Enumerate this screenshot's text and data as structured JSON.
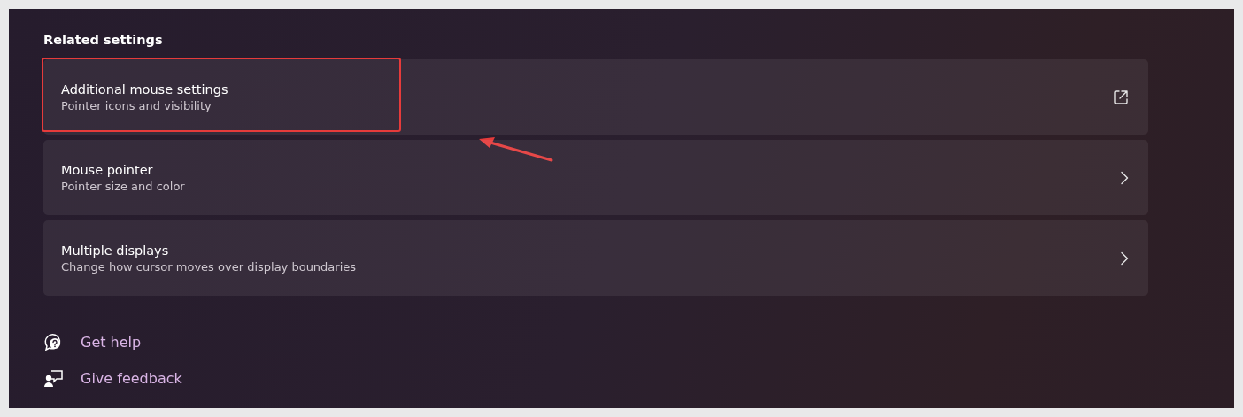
{
  "section_title": "Related settings",
  "rows": [
    {
      "title": "Additional mouse settings",
      "subtitle": "Pointer icons and visibility",
      "kind": "external",
      "highlighted": true
    },
    {
      "title": "Mouse pointer",
      "subtitle": "Pointer size and color",
      "kind": "chevron",
      "highlighted": false
    },
    {
      "title": "Multiple displays",
      "subtitle": "Change how cursor moves over display boundaries",
      "kind": "chevron",
      "highlighted": false
    }
  ],
  "links": [
    {
      "label": "Get help",
      "kind": "help"
    },
    {
      "label": "Give feedback",
      "kind": "feedback"
    }
  ]
}
